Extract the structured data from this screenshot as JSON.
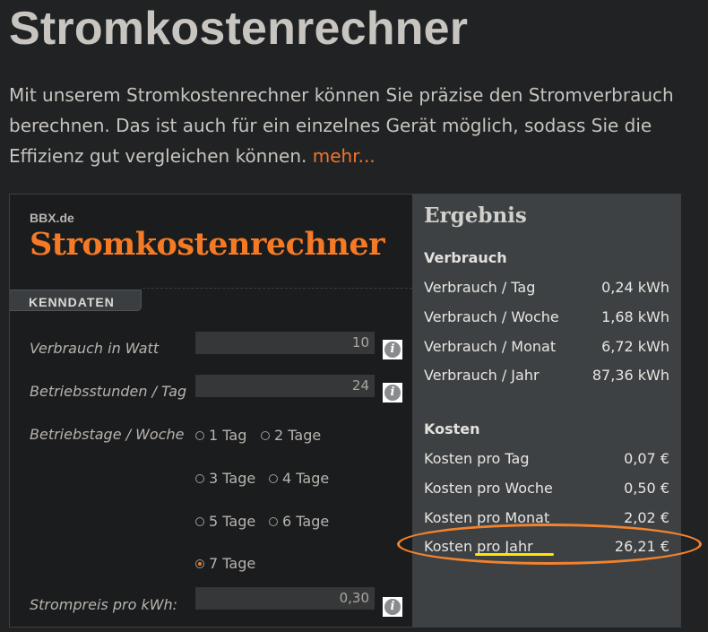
{
  "page": {
    "title": "Stromkostenrechner",
    "intro": "Mit unserem Stromkostenrechner können Sie präzise den Stromverbrauch berechnen. Das ist auch für ein einzelnes Gerät möglich, sodass Sie die Effizienz gut vergleichen können.",
    "more_link": "mehr..."
  },
  "calculator": {
    "brand_small": "BBX.de",
    "brand_big": "Stromkostenrechner",
    "section_tab": "KENNDATEN",
    "fields": {
      "watt": {
        "label": "Verbrauch in Watt",
        "value": "10"
      },
      "hours": {
        "label": "Betriebsstunden / Tag",
        "value": "24"
      },
      "days": {
        "label": "Betriebstage / Woche"
      },
      "price": {
        "label": "Strompreis pro kWh:",
        "value": "0,30"
      }
    },
    "info_icon": "i",
    "day_options": [
      "1 Tag",
      "2 Tage",
      "3 Tage",
      "4 Tage",
      "5 Tage",
      "6 Tage",
      "7 Tage"
    ],
    "selected_day": "7 Tage"
  },
  "results": {
    "title": "Ergebnis",
    "consumption_heading": "Verbrauch",
    "consumption": [
      {
        "label": "Verbrauch / Tag",
        "value": "0,24 kWh"
      },
      {
        "label": "Verbrauch / Woche",
        "value": "1,68 kWh"
      },
      {
        "label": "Verbrauch / Monat",
        "value": "6,72 kWh"
      },
      {
        "label": "Verbrauch / Jahr",
        "value": "87,36 kWh"
      }
    ],
    "cost_heading": "Kosten",
    "costs": [
      {
        "label": "Kosten pro Tag",
        "value": "0,07 €"
      },
      {
        "label": "Kosten pro Woche",
        "value": "0,50 €"
      },
      {
        "label": "Kosten pro Monat",
        "value": "2,02 €"
      },
      {
        "label": "Kosten pro Jahr",
        "value": "26,21 €"
      }
    ]
  },
  "colors": {
    "accent": "#f57a25",
    "highlight_oval": "#f2832e",
    "highlight_underline": "#ffe600"
  }
}
